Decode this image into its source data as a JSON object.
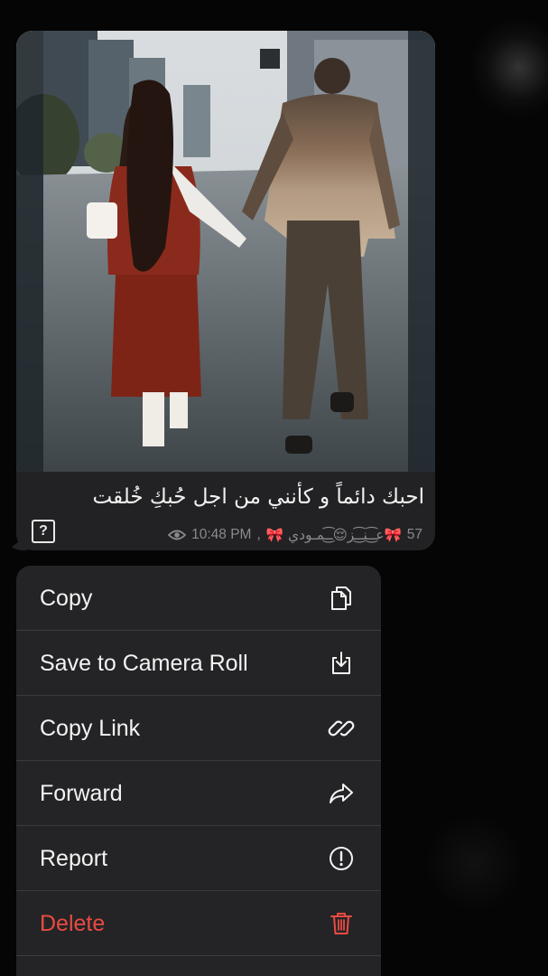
{
  "message": {
    "caption": "احبك دائماً و كأنني من اجل حُبكِ خُلقت",
    "views": "57",
    "signature": "🎀عـ͜͡ـنـ͜͡ـز😌ـ͜͡ـمـودي 🎀",
    "time": "10:48 PM",
    "badge": "?"
  },
  "menu": {
    "items": [
      {
        "label": "Copy",
        "icon": "copy-icon"
      },
      {
        "label": "Save to Camera Roll",
        "icon": "save-download-icon"
      },
      {
        "label": "Copy Link",
        "icon": "link-icon"
      },
      {
        "label": "Forward",
        "icon": "forward-arrow-icon"
      },
      {
        "label": "Report",
        "icon": "report-exclamation-icon"
      },
      {
        "label": "Delete",
        "icon": "trash-icon",
        "color": "#ea4a42"
      }
    ]
  },
  "colors": {
    "background": "#050505",
    "bubble": "#222224",
    "menu": "#242426",
    "danger": "#ea4a42",
    "meta_text": "#8a8a8e"
  }
}
